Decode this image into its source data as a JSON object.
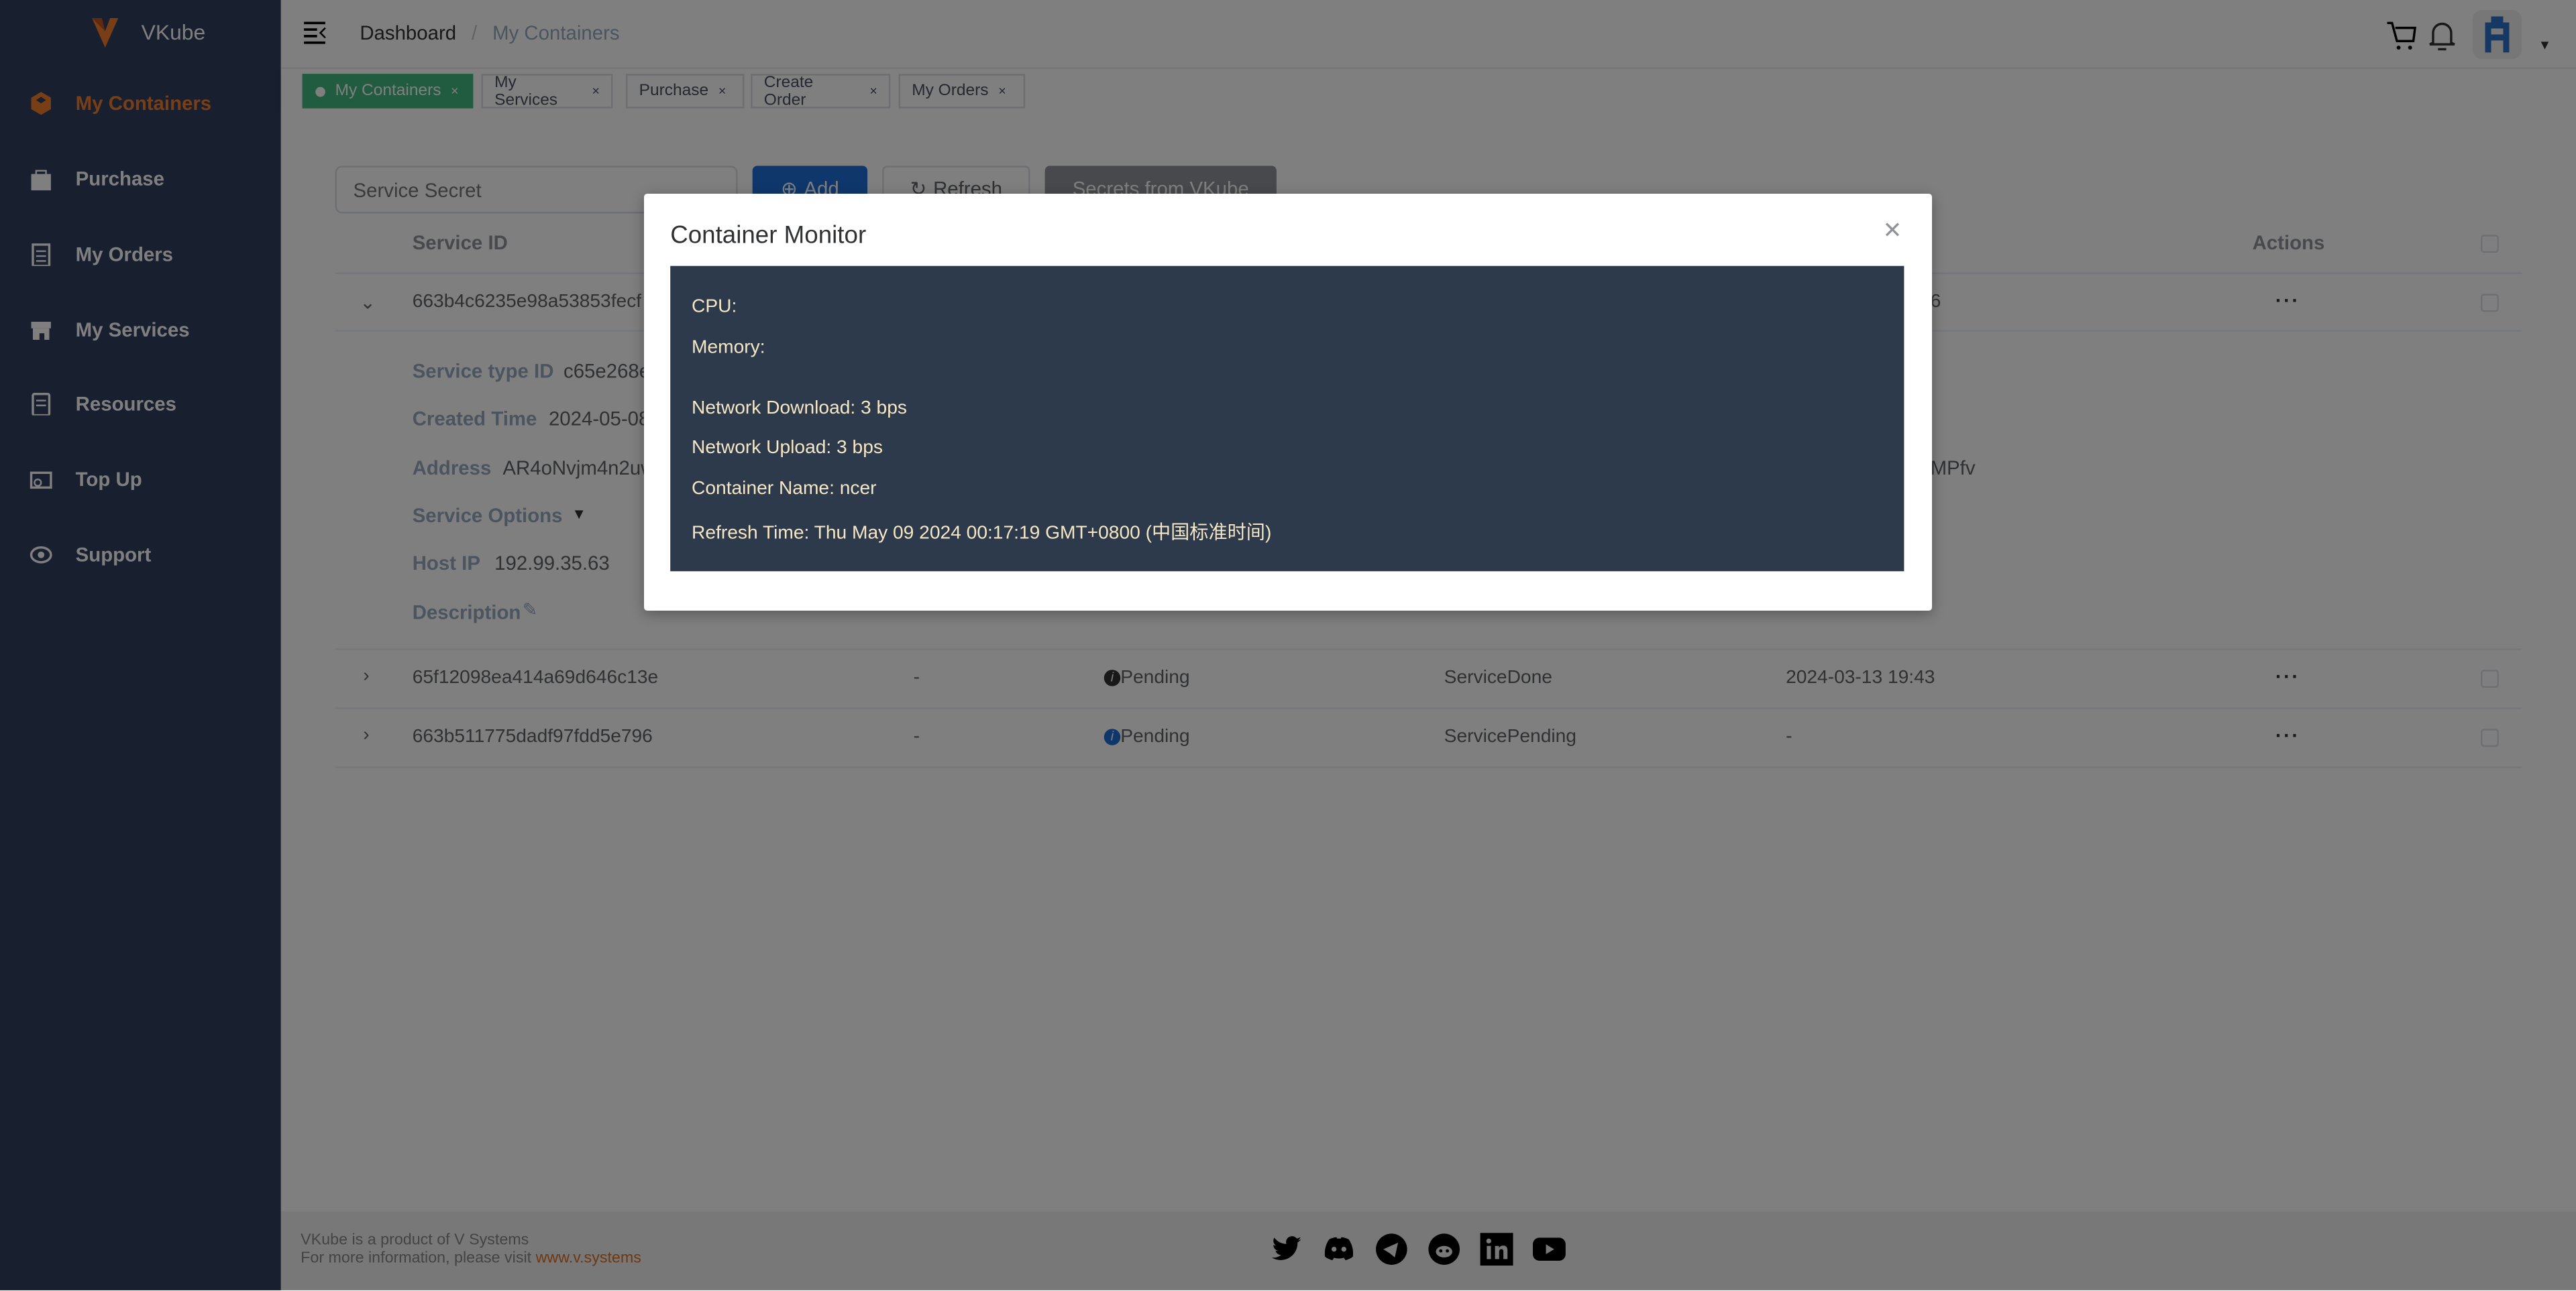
{
  "app": {
    "brand": "VKube",
    "colors": {
      "accent": "#f07d2d",
      "tab_active": "#42b983",
      "primary": "#1e6fd9",
      "panel": "#2d3a4c"
    }
  },
  "sidebar": {
    "items": [
      {
        "label": "My Containers",
        "icon": "cube-icon",
        "active": true
      },
      {
        "label": "Purchase",
        "icon": "bag-icon"
      },
      {
        "label": "My Orders",
        "icon": "clipboard-icon"
      },
      {
        "label": "My Services",
        "icon": "store-icon"
      },
      {
        "label": "Resources",
        "icon": "document-icon"
      },
      {
        "label": "Top Up",
        "icon": "wallet-icon"
      },
      {
        "label": "Support",
        "icon": "headset-icon"
      }
    ]
  },
  "header": {
    "breadcrumb": [
      "Dashboard",
      "/",
      "My Containers"
    ]
  },
  "tabs": [
    {
      "label": "My Containers",
      "active": true
    },
    {
      "label": "My Services"
    },
    {
      "label": "Purchase"
    },
    {
      "label": "Create Order"
    },
    {
      "label": "My Orders"
    }
  ],
  "toolbar": {
    "secret_placeholder": "Service Secret",
    "add": "Add",
    "refresh": "Refresh",
    "secrets": "Secrets from VKube"
  },
  "table": {
    "headers": {
      "service_id": "Service ID",
      "actions": "Actions"
    },
    "rows": [
      {
        "id": "663b4c6235e98a53853fecf",
        "tail": "6",
        "expanded": true
      },
      {
        "id": "65f12098ea414a69d646c13e",
        "col2": "-",
        "status": "Pending",
        "state": "ServiceDone",
        "time": "2024-03-13 19:43"
      },
      {
        "id": "663b511775dadf97fdd5e796",
        "col2": "-",
        "status": "Pending",
        "state": "ServicePending",
        "time": "-"
      }
    ],
    "details": {
      "service_type_id_label": "Service type ID",
      "service_type_id": "c65e268e",
      "created_label": "Created Time",
      "created": "2024-05-08",
      "address_label": "Address",
      "address": "AR4oNvjm4n2uw",
      "address_tail": "MPfv",
      "options_label": "Service Options",
      "host_ip_label": "Host IP",
      "host_ip": "192.99.35.63",
      "description_label": "Description"
    }
  },
  "modal": {
    "title": "Container Monitor",
    "cpu": "CPU:",
    "memory": "Memory:",
    "download": "Network Download: 3 bps",
    "upload": "Network Upload: 3 bps",
    "name": "Container Name: ncer",
    "refresh_time": "Refresh Time: Thu May 09 2024 00:17:19 GMT+0800 (中国标准时间)"
  },
  "footer": {
    "line1": "VKube is a product of V Systems",
    "line2": "For more information, please visit ",
    "link": "www.v.systems",
    "social": [
      "twitter-icon",
      "discord-icon",
      "telegram-icon",
      "reddit-icon",
      "linkedin-icon",
      "youtube-icon"
    ]
  }
}
